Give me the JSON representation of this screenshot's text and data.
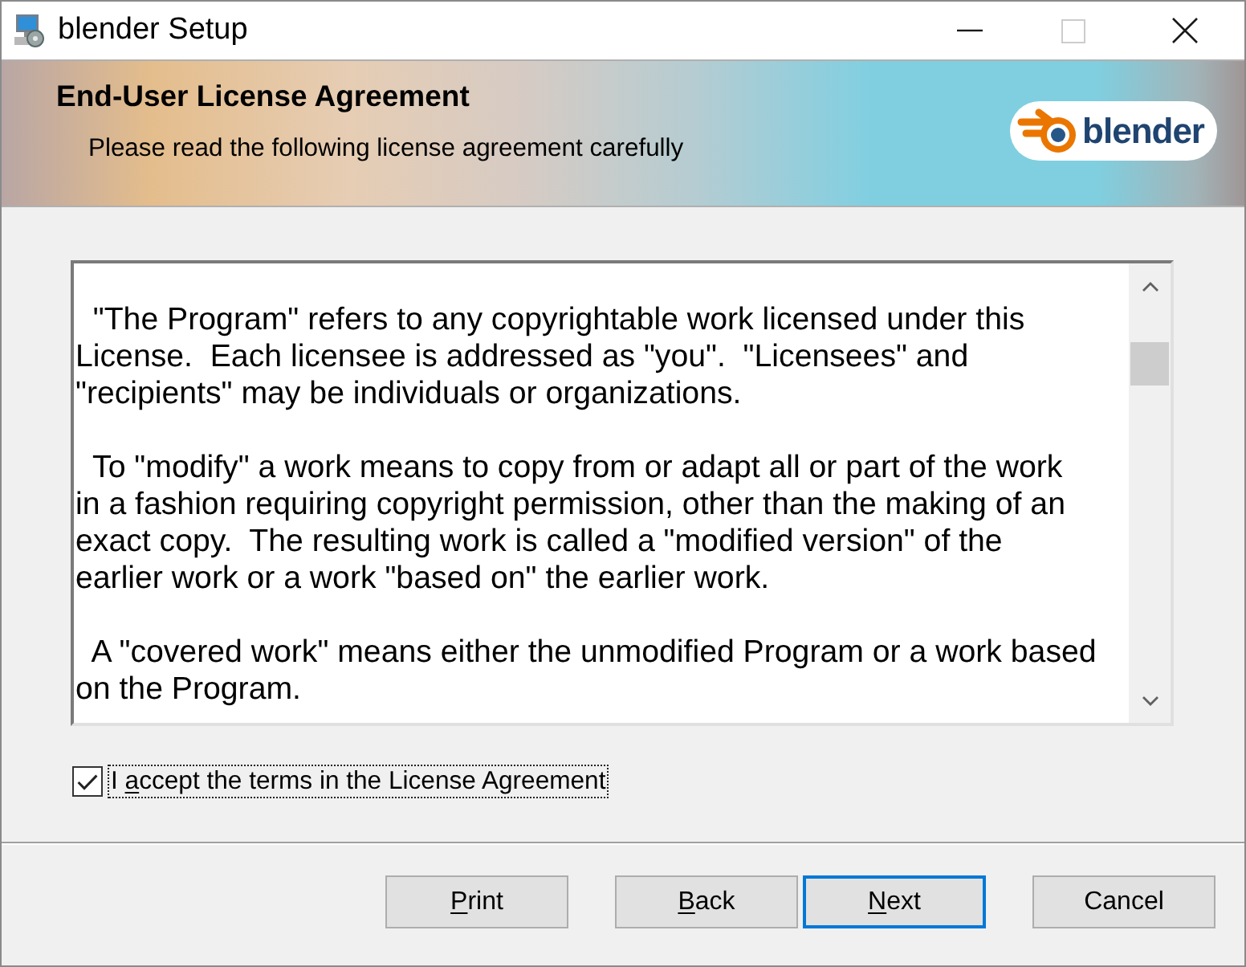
{
  "window": {
    "title": "blender Setup",
    "controls": [
      {
        "kind": "minimize",
        "disabled": false
      },
      {
        "kind": "maximize",
        "disabled": true
      },
      {
        "kind": "close",
        "disabled": false
      }
    ]
  },
  "banner": {
    "title": "End-User License Agreement",
    "subtitle": "Please read the following license agreement carefully",
    "logo_text": "blender"
  },
  "license": {
    "paragraphs": [
      {
        "lines": [
          "  \"The Program\" refers to any copyrightable work licensed under this",
          "License.  Each licensee is addressed as \"you\".  \"Licensees\" and",
          "\"recipients\" may be individuals or organizations."
        ]
      },
      {
        "lines": [
          "  To \"modify\" a work means to copy from or adapt all or part of the work",
          "in a fashion requiring copyright permission, other than the making of an",
          "exact copy.  The resulting work is called a \"modified version\" of the",
          "earlier work or a work \"based on\" the earlier work."
        ]
      },
      {
        "lines": [
          "  A \"covered work\" means either the unmodified Program or a work based",
          "on the Program."
        ]
      }
    ]
  },
  "accept": {
    "checked": true,
    "focused": true,
    "label": [
      {
        "text": "I ",
        "underline": false
      },
      {
        "text": "a",
        "underline": true
      },
      {
        "text": "ccept the terms in the License Agreement",
        "underline": false
      }
    ]
  },
  "buttons": [
    {
      "label": [
        {
          "text": "P",
          "underline": true
        },
        {
          "text": "rint",
          "underline": false
        }
      ],
      "default": false
    },
    {
      "label": [
        {
          "text": "B",
          "underline": true
        },
        {
          "text": "ack",
          "underline": false
        }
      ],
      "default": false
    },
    {
      "label": [
        {
          "text": "N",
          "underline": true
        },
        {
          "text": "ext",
          "underline": false
        }
      ],
      "default": true
    },
    {
      "label": [
        {
          "text": "Cancel",
          "underline": false
        }
      ],
      "default": false
    }
  ]
}
